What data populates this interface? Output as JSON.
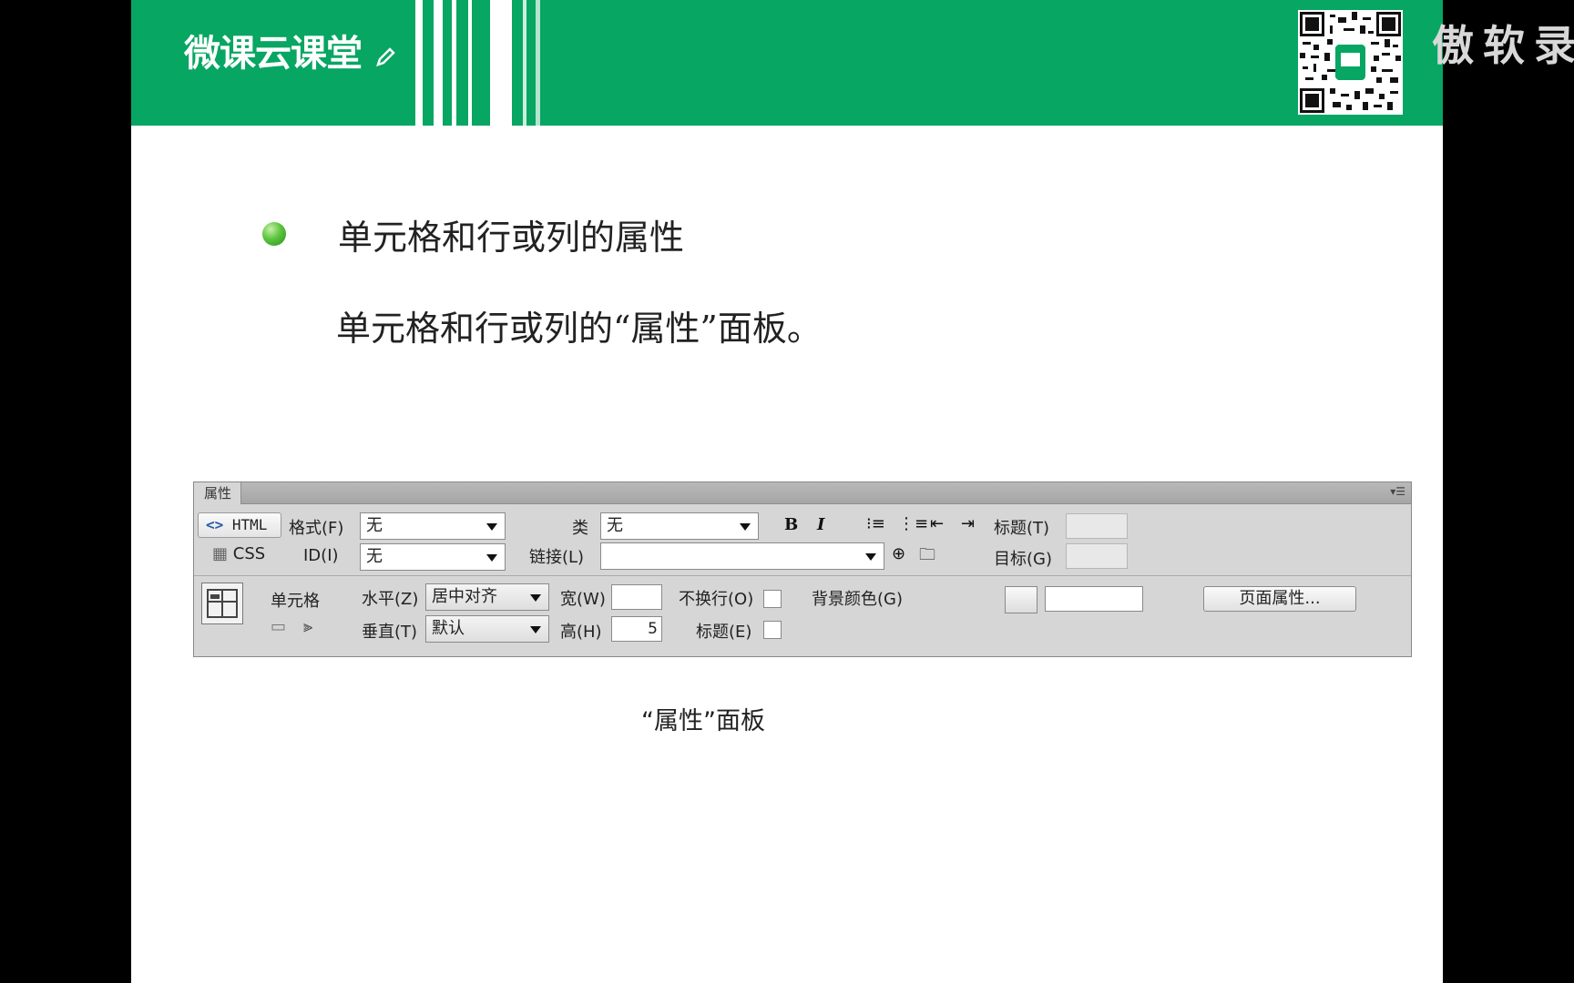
{
  "brand": {
    "logo_text": "微课云课堂",
    "watermark": "傲软录"
  },
  "slide": {
    "heading": "单元格和行或列的属性",
    "subheading": "单元格和行或列的“属性”面板。",
    "caption": "“属性”面板"
  },
  "panel": {
    "tab_label": "属性",
    "html_button": "HTML",
    "css_button": "CSS",
    "format_label": "格式(F)",
    "format_value": "无",
    "id_label": "ID(I)",
    "id_value": "无",
    "class_label": "类",
    "class_value": "无",
    "link_label": "链接(L)",
    "link_value": "",
    "bold": "B",
    "italic": "I",
    "title_label": "标题(T)",
    "target_label": "目标(G)",
    "cell_label": "单元格",
    "horizontal_label": "水平(Z)",
    "horizontal_value": "居中对齐",
    "vertical_label": "垂直(T)",
    "vertical_value": "默认",
    "width_label": "宽(W)",
    "width_value": "",
    "height_label": "高(H)",
    "height_value": "5",
    "nowrap_label": "不换行(O)",
    "header_label": "标题(E)",
    "bgcolor_label": "背景颜色(G)",
    "bgcolor_value": "",
    "page_props_button": "页面属性..."
  }
}
